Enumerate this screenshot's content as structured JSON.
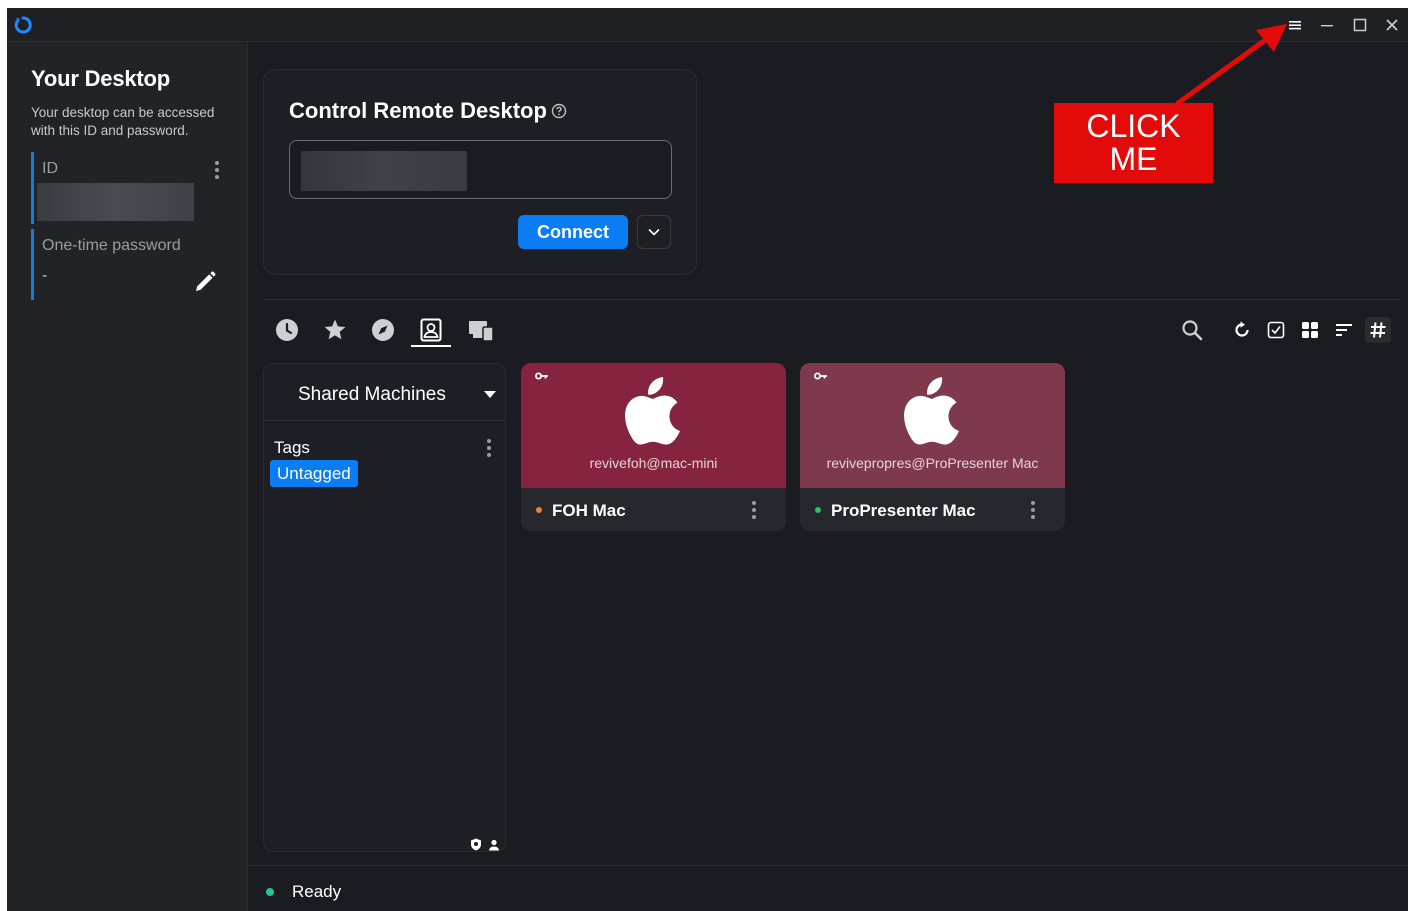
{
  "left_pane": {
    "title": "Your Desktop",
    "description": "Your desktop can be accessed with this ID and password.",
    "id_label": "ID",
    "password_label": "One-time password",
    "password_value": "-"
  },
  "control": {
    "title": "Control Remote Desktop",
    "input_value": "",
    "connect_label": "Connect"
  },
  "tabs": [
    {
      "icon": "history-icon"
    },
    {
      "icon": "star-icon"
    },
    {
      "icon": "compass-icon"
    },
    {
      "icon": "address-book-icon",
      "selected": true
    },
    {
      "icon": "devices-icon"
    }
  ],
  "tags_panel": {
    "group": "Shared Machines",
    "tags_label": "Tags",
    "tags": [
      "Untagged"
    ]
  },
  "machines": [
    {
      "user": "revivefoh@mac-mini",
      "name": "FOH Mac",
      "status_color": "#f0812a",
      "card_color": "#86243f"
    },
    {
      "user": "revivepropres@ProPresenter Mac",
      "name": "ProPresenter Mac",
      "status_color": "#27c26a",
      "card_color": "#7e394d"
    }
  ],
  "status": {
    "text": "Ready"
  },
  "annotation": {
    "line1": "CLICK",
    "line2": "ME"
  },
  "colors": {
    "accent": "#0a7cf4",
    "background": "#1b1c21",
    "annotation": "#e30a0a"
  }
}
